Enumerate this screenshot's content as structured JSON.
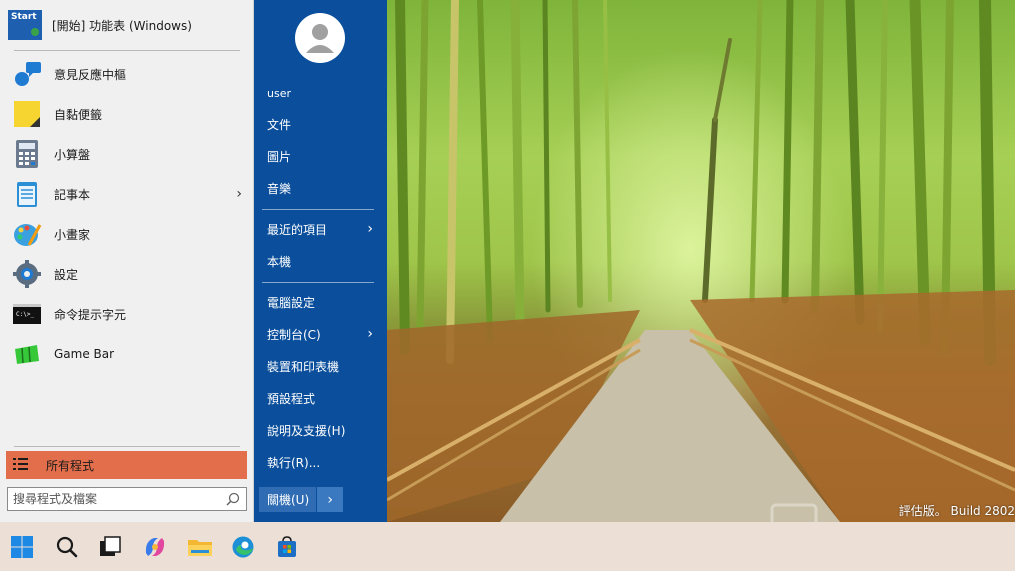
{
  "start_menu": {
    "header_label": "[開始] 功能表 (Windows)",
    "logo_text": "Start",
    "programs": [
      {
        "label": "意見反應中樞",
        "icon": "feedback-hub-icon",
        "has_submenu": false
      },
      {
        "label": "自黏便籤",
        "icon": "sticky-notes-icon",
        "has_submenu": false
      },
      {
        "label": "小算盤",
        "icon": "calculator-icon",
        "has_submenu": false
      },
      {
        "label": "記事本",
        "icon": "notepad-icon",
        "has_submenu": true
      },
      {
        "label": "小畫家",
        "icon": "paint-icon",
        "has_submenu": false
      },
      {
        "label": "設定",
        "icon": "settings-gear-icon",
        "has_submenu": false
      },
      {
        "label": "命令提示字元",
        "icon": "command-prompt-icon",
        "has_submenu": false
      },
      {
        "label": "Game Bar",
        "icon": "game-bar-icon",
        "has_submenu": false
      }
    ],
    "all_programs_label": "所有程式",
    "search": {
      "placeholder": "搜尋程式及檔案",
      "value": ""
    },
    "right_pane": {
      "user_label": "user",
      "items": [
        {
          "label": "文件",
          "has_submenu": false
        },
        {
          "label": "圖片",
          "has_submenu": false
        },
        {
          "label": "音樂",
          "has_submenu": false
        },
        {
          "label": "最近的項目",
          "has_submenu": true
        },
        {
          "label": "本機",
          "has_submenu": false
        },
        {
          "label": "電腦設定",
          "has_submenu": false
        },
        {
          "label": "控制台(C)",
          "has_submenu": true
        },
        {
          "label": "裝置和印表機",
          "has_submenu": false
        },
        {
          "label": "預設程式",
          "has_submenu": false
        },
        {
          "label": "說明及支援(H)",
          "has_submenu": false
        },
        {
          "label": "執行(R)...",
          "has_submenu": false
        }
      ],
      "shutdown_label": "關機(U)"
    }
  },
  "desktop": {
    "watermark": "評估版。 Build 2802"
  },
  "taskbar": {
    "icons": [
      "windows-start-icon",
      "search-icon",
      "task-view-icon",
      "copilot-icon",
      "file-explorer-icon",
      "edge-browser-icon",
      "microsoft-store-icon"
    ]
  },
  "colors": {
    "accent_all_programs": "#e36e4b",
    "right_pane": "#0b4f9c",
    "taskbar": "#ecdfd6"
  }
}
